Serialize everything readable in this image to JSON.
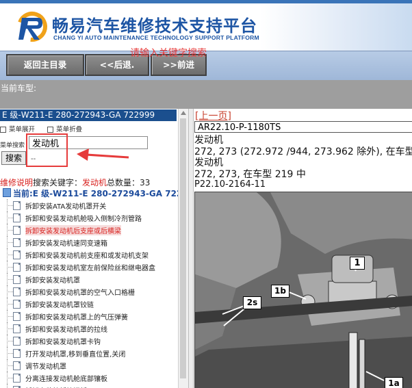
{
  "header": {
    "title": "畅易汽车维修技术支持平台",
    "subtitle": "CHANG YI AUTO MAINTENANCE TECHNOLOGY SUPPORT PLATFORM"
  },
  "nav": {
    "home_label": "返回主目录",
    "back_label": "<<后退.",
    "forward_label": ">>前进"
  },
  "infobar": {
    "current_model_label": "当前车型:"
  },
  "left": {
    "model": "E 级-W211-E 280-272943-GA 722999",
    "expand_label": "菜单展开",
    "collapse_label": "菜单折叠",
    "search_label": "菜单搜索",
    "search_value": "发动机",
    "search_button": "搜索",
    "search_dash": "--",
    "annotation": "请输入关键字搜索",
    "results": {
      "prefix": "维修说明",
      "middle": "搜索关键字：",
      "keyword": "发动机",
      "total_label": "总数量：",
      "total": "33"
    },
    "current_node": "当前:E 级-W211-E 280-272943-GA 722",
    "items": [
      "拆卸安装ATA发动机罩开关",
      "拆卸和安装发动机舱吸入侧制冷剂管路",
      "拆卸安装发动机后支座或后横梁",
      "拆卸安装发动机速同变速箱",
      "拆卸和安装发动机前支座和或发动机支架",
      "拆卸和安装发动机室左前保险丝和继电器盒",
      "拆卸安装发动机罩",
      "拆卸和安装发动机罩的空气入口格栅",
      "拆卸安装发动机罩铰链",
      "拆卸和安装发动机罩上的气压弹簧",
      "拆卸和安装发动机罩的拉线",
      "拆卸和安装发动机罩卡钩",
      "打开发动机罩,移到垂直位置,关闭",
      "调节发动机罩",
      "分离连接发动机舱底部镶板",
      "拆卸安装护板挡泥板"
    ],
    "active_index": 2
  },
  "right": {
    "prev_page": "[上一页]",
    "doc_code": "AR22.10-P-1180TS",
    "line1": "发动机",
    "line2": "272, 273 (272.972 /944, 273.962 除外), 在车型 219 中",
    "line3": "发动机",
    "line4": "272, 273, 在车型 219 中",
    "line5": "P22.10-2164-11",
    "figure_callouts": [
      "1",
      "1b",
      "2s",
      "1a"
    ]
  }
}
